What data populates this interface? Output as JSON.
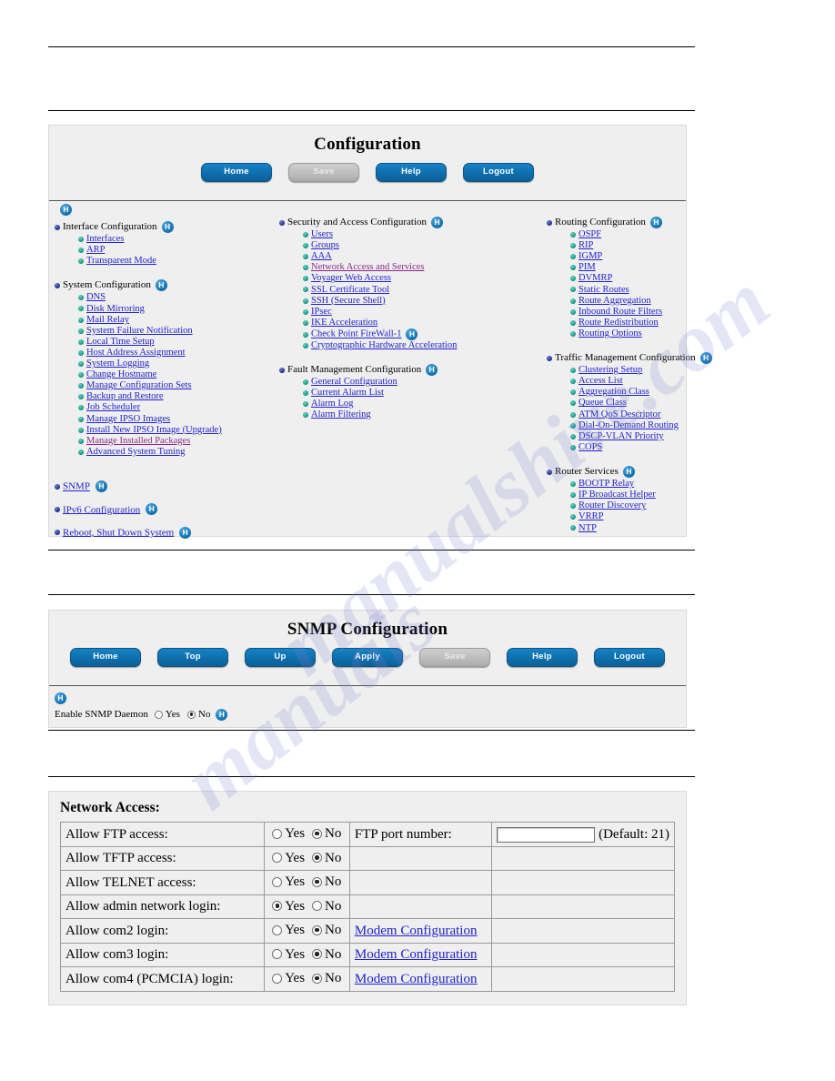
{
  "watermark": {
    "line1": "manualshive.com",
    "line2": "manuals"
  },
  "config_panel": {
    "title": "Configuration",
    "buttons": [
      {
        "label": "Home",
        "state": "enabled"
      },
      {
        "label": "Save",
        "state": "disabled"
      },
      {
        "label": "Help",
        "state": "enabled"
      },
      {
        "label": "Logout",
        "state": "enabled"
      }
    ],
    "help_icon": "H",
    "columns": {
      "left": {
        "groups": [
          {
            "title": "Interface Configuration",
            "help": "H",
            "items": [
              {
                "label": "Interfaces",
                "visited": false
              },
              {
                "label": "ARP",
                "visited": false
              },
              {
                "label": "Transparent Mode",
                "visited": false
              }
            ]
          },
          {
            "title": "System Configuration",
            "help": "H",
            "items": [
              {
                "label": "DNS",
                "visited": false
              },
              {
                "label": "Disk Mirroring",
                "visited": false
              },
              {
                "label": "Mail Relay",
                "visited": false
              },
              {
                "label": "System Failure Notification",
                "visited": false
              },
              {
                "label": "Local Time Setup",
                "visited": false
              },
              {
                "label": "Host Address Assignment",
                "visited": false
              },
              {
                "label": "System Logging",
                "visited": false
              },
              {
                "label": "Change Hostname",
                "visited": false
              },
              {
                "label": "Manage Configuration Sets",
                "visited": false
              },
              {
                "label": "Backup and Restore",
                "visited": false
              },
              {
                "label": "Job Scheduler",
                "visited": false
              },
              {
                "label": "Manage IPSO Images",
                "visited": false
              },
              {
                "label": "Install New IPSO Image (Upgrade)",
                "visited": false
              },
              {
                "label": "Manage Installed Packages",
                "visited": true
              },
              {
                "label": "Advanced System Tuning",
                "visited": false
              }
            ]
          }
        ],
        "standalone": [
          {
            "label": "SNMP",
            "help": "H"
          },
          {
            "label": "IPv6 Configuration",
            "help": "H"
          },
          {
            "label": "Reboot, Shut Down System",
            "help": "H"
          }
        ]
      },
      "middle": {
        "groups": [
          {
            "title": "Security and Access Configuration",
            "help": "H",
            "items": [
              {
                "label": "Users",
                "visited": false
              },
              {
                "label": "Groups",
                "visited": false
              },
              {
                "label": "AAA",
                "visited": false
              },
              {
                "label": "Network Access and Services",
                "visited": true
              },
              {
                "label": "Voyager Web Access",
                "visited": false
              },
              {
                "label": "SSL Certificate Tool",
                "visited": false
              },
              {
                "label": "SSH (Secure Shell)",
                "visited": false
              },
              {
                "label": "IPsec",
                "visited": false
              },
              {
                "label": "IKE Acceleration",
                "visited": false
              },
              {
                "label": "Check Point FireWall-1",
                "visited": false,
                "help": "H"
              },
              {
                "label": "Cryptographic Hardware Acceleration",
                "visited": false
              }
            ]
          },
          {
            "title": "Fault Management Configuration",
            "help": "H",
            "items": [
              {
                "label": "General Configuration",
                "visited": false
              },
              {
                "label": "Current Alarm List",
                "visited": false
              },
              {
                "label": "Alarm Log",
                "visited": false
              },
              {
                "label": "Alarm Filtering",
                "visited": false
              }
            ]
          }
        ],
        "standalone": []
      },
      "right": {
        "groups": [
          {
            "title": "Routing Configuration",
            "help": "H",
            "items": [
              {
                "label": "OSPF",
                "visited": false
              },
              {
                "label": "RIP",
                "visited": false
              },
              {
                "label": "IGMP",
                "visited": false
              },
              {
                "label": "PIM",
                "visited": false
              },
              {
                "label": "DVMRP",
                "visited": false
              },
              {
                "label": "Static Routes",
                "visited": false
              },
              {
                "label": "Route Aggregation",
                "visited": false
              },
              {
                "label": "Inbound Route Filters",
                "visited": false
              },
              {
                "label": "Route Redistribution",
                "visited": false
              },
              {
                "label": "Routing Options",
                "visited": false
              }
            ]
          },
          {
            "title": "Traffic Management Configuration",
            "help": "H",
            "items": [
              {
                "label": "Clustering Setup",
                "visited": false
              },
              {
                "label": "Access List",
                "visited": false
              },
              {
                "label": "Aggregation Class",
                "visited": false
              },
              {
                "label": "Queue Class",
                "visited": false
              },
              {
                "label": "ATM QoS Descriptor",
                "visited": false
              },
              {
                "label": "Dial-On-Demand Routing",
                "visited": false
              },
              {
                "label": "DSCP-VLAN Priority",
                "visited": false
              },
              {
                "label": "COPS",
                "visited": false
              }
            ]
          },
          {
            "title": "Router Services",
            "help": "H",
            "items": [
              {
                "label": "BOOTP Relay",
                "visited": false
              },
              {
                "label": "IP Broadcast Helper",
                "visited": false
              },
              {
                "label": "Router Discovery",
                "visited": false
              },
              {
                "label": "VRRP",
                "visited": false
              },
              {
                "label": "NTP",
                "visited": false
              }
            ]
          }
        ],
        "standalone": []
      }
    }
  },
  "snmp_panel": {
    "title": "SNMP Configuration",
    "buttons": [
      {
        "label": "Home",
        "state": "enabled"
      },
      {
        "label": "Top",
        "state": "enabled"
      },
      {
        "label": "Up",
        "state": "enabled"
      },
      {
        "label": "Apply",
        "state": "enabled"
      },
      {
        "label": "Save",
        "state": "disabled"
      },
      {
        "label": "Help",
        "state": "enabled"
      },
      {
        "label": "Logout",
        "state": "enabled"
      }
    ],
    "help_icon": "H",
    "daemon": {
      "label": "Enable SNMP Daemon",
      "yes_label": "Yes",
      "no_label": "No",
      "selected": "No",
      "help": "H"
    }
  },
  "network_access_panel": {
    "title": "Network Access:",
    "yes_label": "Yes",
    "no_label": "No",
    "rows": [
      {
        "label": "Allow FTP access:",
        "selected": "No",
        "extra": null
      },
      {
        "label": "Allow TFTP access:",
        "selected": "No",
        "extra": null
      },
      {
        "label": "Allow TELNET access:",
        "selected": "No",
        "extra": null
      },
      {
        "label": "Allow admin network login:",
        "selected": "Yes",
        "extra": null
      },
      {
        "label": "Allow com2 login:",
        "selected": "No",
        "extra": "Modem Configuration"
      },
      {
        "label": "Allow com3 login:",
        "selected": "No",
        "extra": "Modem Configuration"
      },
      {
        "label": "Allow com4 (PCMCIA) login:",
        "selected": "No",
        "extra": "Modem Configuration"
      }
    ],
    "ftp_port": {
      "label": "FTP port number:",
      "value": "",
      "placeholder": "",
      "default_note": "(Default: 21)"
    }
  }
}
